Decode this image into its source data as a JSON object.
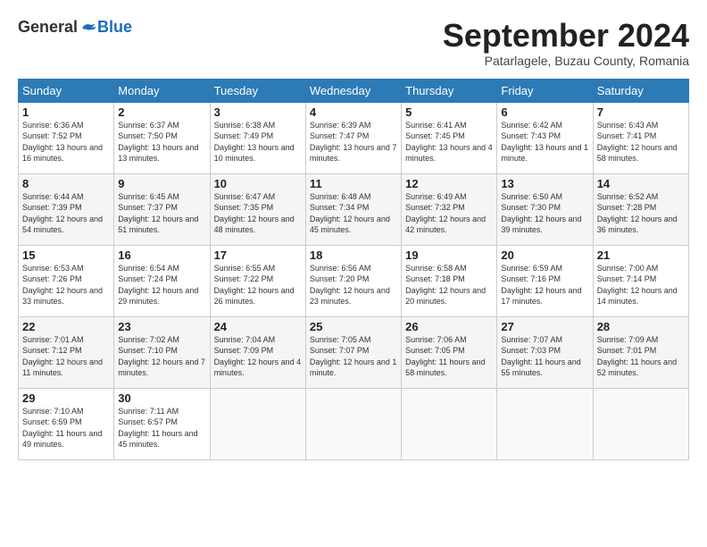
{
  "header": {
    "logo_general": "General",
    "logo_blue": "Blue",
    "month_title": "September 2024",
    "subtitle": "Patarlagele, Buzau County, Romania"
  },
  "weekdays": [
    "Sunday",
    "Monday",
    "Tuesday",
    "Wednesday",
    "Thursday",
    "Friday",
    "Saturday"
  ],
  "weeks": [
    [
      {
        "day": "1",
        "sunrise": "6:36 AM",
        "sunset": "7:52 PM",
        "daylight": "13 hours and 16 minutes."
      },
      {
        "day": "2",
        "sunrise": "6:37 AM",
        "sunset": "7:50 PM",
        "daylight": "13 hours and 13 minutes."
      },
      {
        "day": "3",
        "sunrise": "6:38 AM",
        "sunset": "7:49 PM",
        "daylight": "13 hours and 10 minutes."
      },
      {
        "day": "4",
        "sunrise": "6:39 AM",
        "sunset": "7:47 PM",
        "daylight": "13 hours and 7 minutes."
      },
      {
        "day": "5",
        "sunrise": "6:41 AM",
        "sunset": "7:45 PM",
        "daylight": "13 hours and 4 minutes."
      },
      {
        "day": "6",
        "sunrise": "6:42 AM",
        "sunset": "7:43 PM",
        "daylight": "13 hours and 1 minute."
      },
      {
        "day": "7",
        "sunrise": "6:43 AM",
        "sunset": "7:41 PM",
        "daylight": "12 hours and 58 minutes."
      }
    ],
    [
      {
        "day": "8",
        "sunrise": "6:44 AM",
        "sunset": "7:39 PM",
        "daylight": "12 hours and 54 minutes."
      },
      {
        "day": "9",
        "sunrise": "6:45 AM",
        "sunset": "7:37 PM",
        "daylight": "12 hours and 51 minutes."
      },
      {
        "day": "10",
        "sunrise": "6:47 AM",
        "sunset": "7:35 PM",
        "daylight": "12 hours and 48 minutes."
      },
      {
        "day": "11",
        "sunrise": "6:48 AM",
        "sunset": "7:34 PM",
        "daylight": "12 hours and 45 minutes."
      },
      {
        "day": "12",
        "sunrise": "6:49 AM",
        "sunset": "7:32 PM",
        "daylight": "12 hours and 42 minutes."
      },
      {
        "day": "13",
        "sunrise": "6:50 AM",
        "sunset": "7:30 PM",
        "daylight": "12 hours and 39 minutes."
      },
      {
        "day": "14",
        "sunrise": "6:52 AM",
        "sunset": "7:28 PM",
        "daylight": "12 hours and 36 minutes."
      }
    ],
    [
      {
        "day": "15",
        "sunrise": "6:53 AM",
        "sunset": "7:26 PM",
        "daylight": "12 hours and 33 minutes."
      },
      {
        "day": "16",
        "sunrise": "6:54 AM",
        "sunset": "7:24 PM",
        "daylight": "12 hours and 29 minutes."
      },
      {
        "day": "17",
        "sunrise": "6:55 AM",
        "sunset": "7:22 PM",
        "daylight": "12 hours and 26 minutes."
      },
      {
        "day": "18",
        "sunrise": "6:56 AM",
        "sunset": "7:20 PM",
        "daylight": "12 hours and 23 minutes."
      },
      {
        "day": "19",
        "sunrise": "6:58 AM",
        "sunset": "7:18 PM",
        "daylight": "12 hours and 20 minutes."
      },
      {
        "day": "20",
        "sunrise": "6:59 AM",
        "sunset": "7:16 PM",
        "daylight": "12 hours and 17 minutes."
      },
      {
        "day": "21",
        "sunrise": "7:00 AM",
        "sunset": "7:14 PM",
        "daylight": "12 hours and 14 minutes."
      }
    ],
    [
      {
        "day": "22",
        "sunrise": "7:01 AM",
        "sunset": "7:12 PM",
        "daylight": "12 hours and 11 minutes."
      },
      {
        "day": "23",
        "sunrise": "7:02 AM",
        "sunset": "7:10 PM",
        "daylight": "12 hours and 7 minutes."
      },
      {
        "day": "24",
        "sunrise": "7:04 AM",
        "sunset": "7:09 PM",
        "daylight": "12 hours and 4 minutes."
      },
      {
        "day": "25",
        "sunrise": "7:05 AM",
        "sunset": "7:07 PM",
        "daylight": "12 hours and 1 minute."
      },
      {
        "day": "26",
        "sunrise": "7:06 AM",
        "sunset": "7:05 PM",
        "daylight": "11 hours and 58 minutes."
      },
      {
        "day": "27",
        "sunrise": "7:07 AM",
        "sunset": "7:03 PM",
        "daylight": "11 hours and 55 minutes."
      },
      {
        "day": "28",
        "sunrise": "7:09 AM",
        "sunset": "7:01 PM",
        "daylight": "11 hours and 52 minutes."
      }
    ],
    [
      {
        "day": "29",
        "sunrise": "7:10 AM",
        "sunset": "6:59 PM",
        "daylight": "11 hours and 49 minutes."
      },
      {
        "day": "30",
        "sunrise": "7:11 AM",
        "sunset": "6:57 PM",
        "daylight": "11 hours and 45 minutes."
      },
      null,
      null,
      null,
      null,
      null
    ]
  ]
}
